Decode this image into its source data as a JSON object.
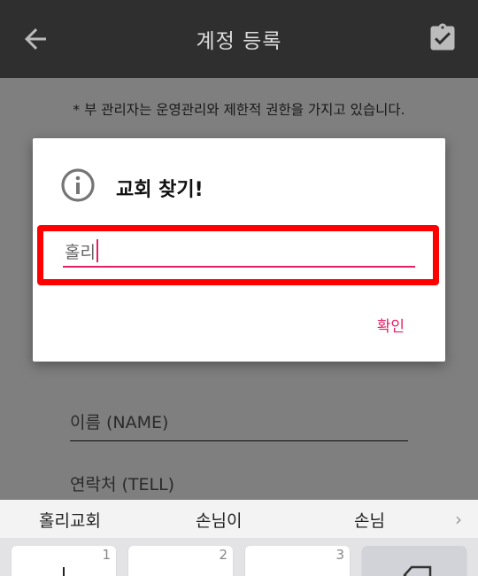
{
  "app_bar": {
    "title": "계정 등록",
    "back_icon": "arrow-left-icon",
    "action_icon": "clipboard-check-icon"
  },
  "page": {
    "notice": "* 부 관리자는 운영관리와 제한적 권한을 가지고 있습니다.",
    "name_placeholder": "이름 (NAME)",
    "tell_placeholder": "연락처 (TELL)"
  },
  "dialog": {
    "icon": "info-icon",
    "title": "교회 찾기!",
    "input_value": "홀리",
    "confirm_label": "확인"
  },
  "keyboard": {
    "suggestions": [
      "홀리교회",
      "손님이",
      "손님"
    ],
    "more_icon": "chevron-right-icon",
    "keys": [
      {
        "number": "1"
      },
      {
        "number": "2"
      },
      {
        "number": "3"
      }
    ],
    "delete_icon": "backspace-icon"
  },
  "colors": {
    "accent": "#e91e63",
    "highlight": "#ff0000",
    "app_bar": "#2f2f2f"
  }
}
